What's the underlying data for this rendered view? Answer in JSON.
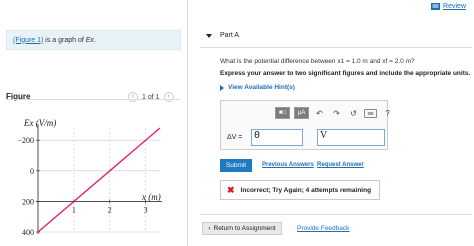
{
  "header": {
    "review_label": "Review"
  },
  "intro": {
    "figure_link": "(Figure 1)",
    "text_after": " is a graph of ",
    "symbol": "Ex",
    "period": "."
  },
  "figure": {
    "title": "Figure",
    "pager": "1 of 1",
    "graph": {
      "y_label": "Ex (V/m)",
      "x_label": "x (m)",
      "y_ticks": [
        "400",
        "200",
        "0",
        "−200"
      ],
      "x_ticks": [
        "1",
        "2",
        "3"
      ]
    }
  },
  "chart_data": {
    "type": "line",
    "xlabel": "x (m)",
    "ylabel": "Ex (V/m)",
    "xlim": [
      0,
      3.4
    ],
    "ylim": [
      -200,
      480
    ],
    "x_ticks": [
      1,
      2,
      3
    ],
    "y_ticks": [
      -200,
      0,
      200,
      400
    ],
    "series": [
      {
        "x": [
          0,
          3.4
        ],
        "y": [
          -200,
          480
        ]
      }
    ],
    "colors": {
      "line": "#e0217a",
      "grid": "#cccccc"
    }
  },
  "part": {
    "label": "Part A",
    "question": "What is the potential difference between x1 = 1.0 m and xf = 2.0 m?",
    "instruction": "Express your answer to two significant figures and include the appropriate units.",
    "hints": "View Available Hint(s)"
  },
  "editor": {
    "toolbar": {
      "templates": "■□",
      "units": "μA",
      "undo": "↶",
      "redo": "↷",
      "reset": "↺",
      "keyboard": "⌨",
      "help": "?"
    },
    "dv_label": "ΔV =",
    "value": "0",
    "unit": "V"
  },
  "actions": {
    "submit": "Submit",
    "previous": "Previous Answers",
    "request": "Request Answer"
  },
  "feedback": {
    "text": "Incorrect; Try Again; 4 attempts remaining"
  },
  "footer": {
    "return": "Return to Assignment",
    "provide": "Provide Feedback"
  }
}
